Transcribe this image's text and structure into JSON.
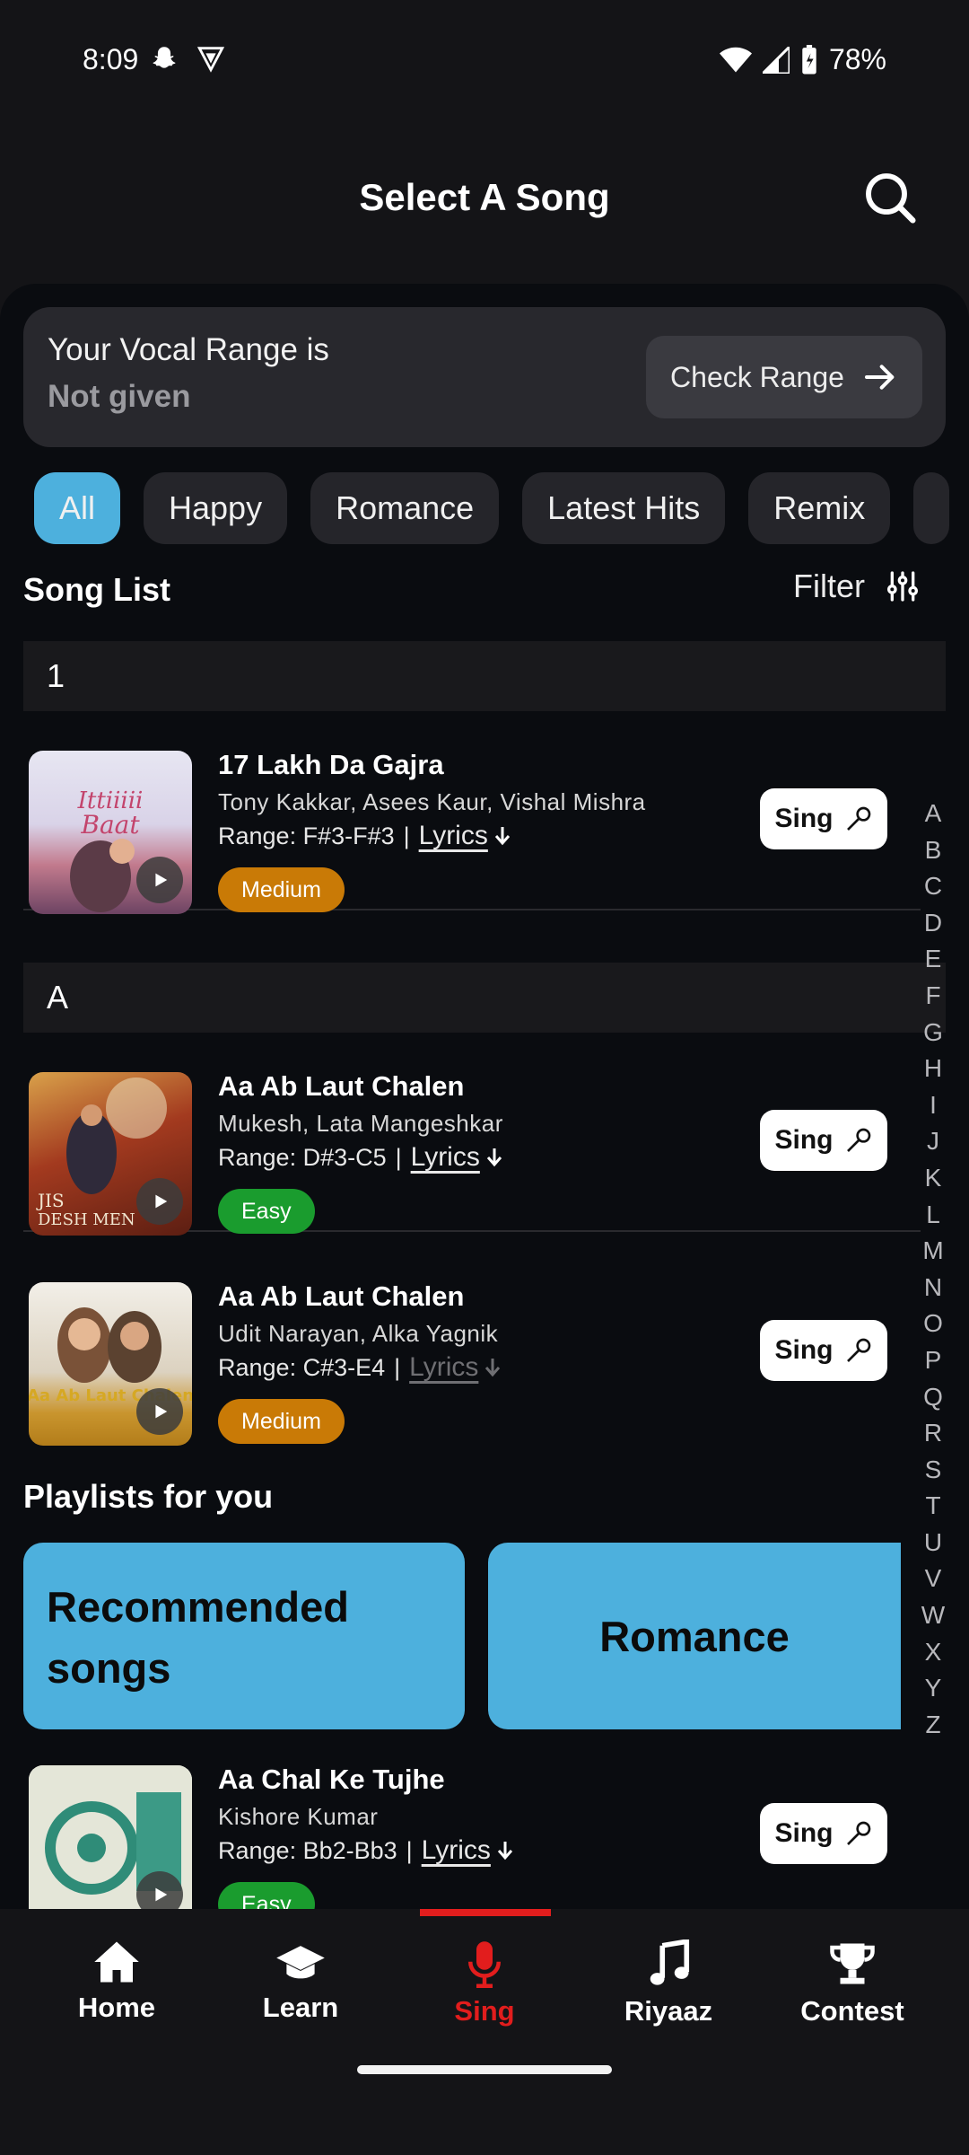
{
  "status_bar": {
    "time": "8:09",
    "battery": "78%"
  },
  "header": {
    "title": "Select A Song"
  },
  "vocal": {
    "label": "Your Vocal Range is",
    "value": "Not given",
    "check_label": "Check Range"
  },
  "chips": [
    "All",
    "Happy",
    "Romance",
    "Latest Hits",
    "Remix"
  ],
  "song_list": {
    "title": "Song List",
    "filter_label": "Filter"
  },
  "sections": [
    "1",
    "A"
  ],
  "songs": [
    {
      "title": "17 Lakh Da Gajra",
      "artists": "Tony Kakkar, Asees Kaur, Vishal Mishra",
      "range": "Range: F#3-F#3",
      "lyrics": "Lyrics",
      "difficulty": "Medium",
      "sing": "Sing"
    },
    {
      "title": "Aa Ab Laut Chalen",
      "artists": "Mukesh, Lata Mangeshkar",
      "range": "Range: D#3-C5",
      "lyrics": "Lyrics",
      "difficulty": "Easy",
      "sing": "Sing"
    },
    {
      "title": "Aa Ab Laut Chalen",
      "artists": "Udit Narayan, Alka Yagnik",
      "range": "Range: C#3-E4",
      "lyrics": "Lyrics",
      "difficulty": "Medium",
      "sing": "Sing"
    },
    {
      "title": "Aa Chal Ke Tujhe",
      "artists": "Kishore Kumar",
      "range": "Range: Bb2-Bb3",
      "lyrics": "Lyrics",
      "difficulty": "Easy",
      "sing": "Sing"
    }
  ],
  "playlists": {
    "title": "Playlists for you",
    "items": [
      "Recommended songs",
      "Romance"
    ]
  },
  "alphabet": [
    "A",
    "B",
    "C",
    "D",
    "E",
    "F",
    "G",
    "H",
    "I",
    "J",
    "K",
    "L",
    "M",
    "N",
    "O",
    "P",
    "Q",
    "R",
    "S",
    "T",
    "U",
    "V",
    "W",
    "X",
    "Y",
    "Z"
  ],
  "nav": [
    {
      "label": "Home",
      "icon": "home-icon"
    },
    {
      "label": "Learn",
      "icon": "graduation-cap-icon"
    },
    {
      "label": "Sing",
      "icon": "microphone-icon"
    },
    {
      "label": "Riyaaz",
      "icon": "music-note-icon"
    },
    {
      "label": "Contest",
      "icon": "trophy-icon"
    }
  ],
  "colors": {
    "accent": "#4db0dd",
    "active_nav": "#e21d1d",
    "medium": "#c97a06",
    "easy": "#1a9c2e"
  }
}
